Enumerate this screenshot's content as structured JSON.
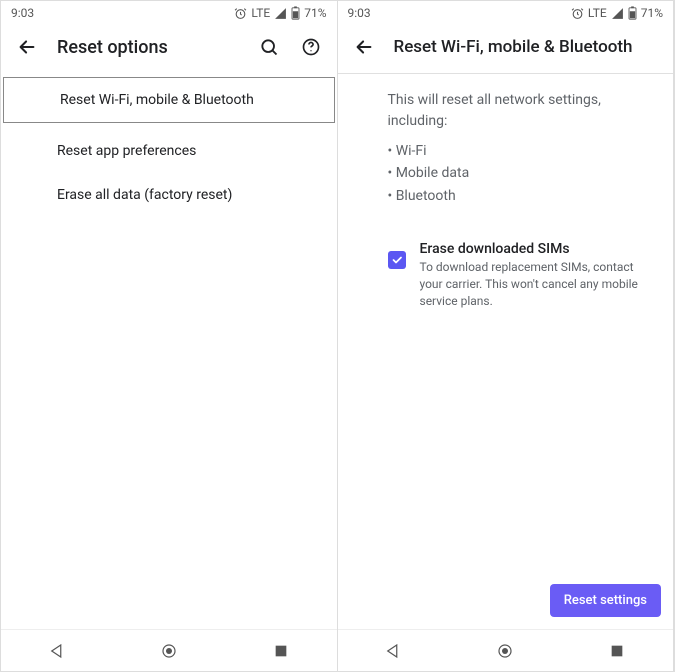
{
  "status": {
    "time": "9:03",
    "network": "LTE",
    "battery": "71%"
  },
  "left": {
    "title": "Reset options",
    "items": [
      "Reset Wi-Fi, mobile & Bluetooth",
      "Reset app preferences",
      "Erase all data (factory reset)"
    ]
  },
  "right": {
    "title": "Reset Wi-Fi, mobile & Bluetooth",
    "intro": "This will reset all network settings, including:",
    "bullets": [
      "Wi-Fi",
      "Mobile data",
      "Bluetooth"
    ],
    "checkbox": {
      "title": "Erase downloaded SIMs",
      "desc": "To download replacement SIMs, contact your carrier. This won't cancel any mobile service plans."
    },
    "action": "Reset settings"
  }
}
